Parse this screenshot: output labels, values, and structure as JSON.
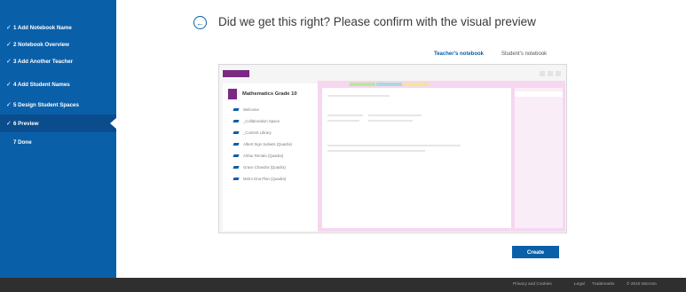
{
  "steps": [
    {
      "label": "1  Add Notebook Name",
      "check": "✓"
    },
    {
      "label": "2  Notebook Overview",
      "check": "✓"
    },
    {
      "label": "3  Add Another Teacher",
      "check": "✓"
    },
    {
      "label": "4  Add Student Names",
      "check": "✓"
    },
    {
      "label": "5  Design Student Spaces",
      "check": "✓"
    },
    {
      "label": "6  Preview",
      "check": "✓"
    },
    {
      "label": "7  Done",
      "check": ""
    }
  ],
  "heading": "Did we get this right? Please confirm with the visual preview",
  "back_icon": "←",
  "tabs": {
    "teacher": "Teacher's notebook",
    "student": "Student's notebook"
  },
  "preview": {
    "notebook_title": "Mathematics Grade 10",
    "sections": [
      "Welcome",
      "_Collaboration Space",
      "_Content Library",
      "Albert Sign Subiets (Quadra)",
      "Arthur Renato (Quadra)",
      "Grace Chandra (Quadra)",
      "Metro Dna Plan (Quadra)"
    ],
    "page_tab_colors": [
      "#bfe3a2",
      "#a8dcd8",
      "#f6e49a"
    ]
  },
  "create_label": "Create",
  "footer": {
    "privacy": "Privacy and Cookies",
    "legal": "Legal",
    "trademarks": "Trademarks",
    "copyright": "© 2015 Microso"
  }
}
